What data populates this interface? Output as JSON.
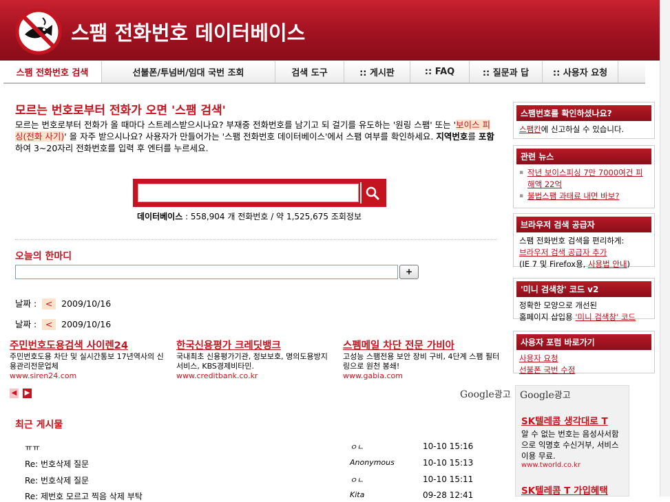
{
  "header": {
    "title": "스팸 전화번호 데이터베이스"
  },
  "nav": [
    {
      "label": "스팸 전화번호 검색",
      "width": 143
    },
    {
      "label": "선불폰/투넘버/임대 국번 조회",
      "width": 252
    },
    {
      "label": "검색 도구",
      "width": 100
    },
    {
      "label": ":: 게시판",
      "width": 96
    },
    {
      "label": ":: FAQ",
      "width": 86
    },
    {
      "label": ":: 질문과 답",
      "width": 106
    },
    {
      "label": ":: 사용자 요청",
      "width": 110
    }
  ],
  "headline": "모르는 번호로부터 전화가 오면 '스팸 검색'",
  "intro": {
    "part1": "모르는 번호로부터 전화가 올 때마다 스트레스받으시나요? 부재중 전화번호를 남기고 되 걸기를 유도하는 '원링 스팸' 또는 '",
    "phishing": "보이스 피싱(전화 사기)",
    "part2": "' 을 자주 받으시나요? 사용자가 만들어가는 '스팸 전화번호 데이터베이스'에서 스팸 여부를 확인하세요. ",
    "bold1": "지역번호",
    "mid": "를 ",
    "bold2": "포함",
    "part3": "하여 3~20자리 전화번호를 입력 후 엔터를 누르세요."
  },
  "search": {
    "placeholder": "",
    "value": ""
  },
  "db": {
    "label": "데이터베이스",
    "phones": "558,904",
    "phones_unit": "개 전화번호 / 약",
    "info": "1,525,675",
    "info_unit": "조회정보"
  },
  "oneline": {
    "title": "오늘의 한마디",
    "plus": "+"
  },
  "dates": [
    {
      "label": "날짜 :",
      "nav": "<",
      "date": "2009/10/16"
    },
    {
      "label": "날짜 :",
      "nav": "<",
      "date": "2009/10/16"
    }
  ],
  "ads": [
    {
      "title": "주민번호도용검색 사이렌24",
      "desc": "주민번호도용 차단 및 실시간통보 17년역사의 신용관리전문업체",
      "url": "www.siren24.com"
    },
    {
      "title": "한국신용평가 크레딧뱅크",
      "desc": "국내최초 신용평가기관, 정보보호, 명의도용방지 서비스, KBS경제비타민.",
      "url": "www.creditbank.co.kr"
    },
    {
      "title": "스펨메일 차단 전문 가비아",
      "desc": "고성능 스팸전용 보안 장비 구비, 4단계 스팸 필터링으로 원천 봉쇄!",
      "url": "www.gabia.com"
    }
  ],
  "google_label": {
    "brand": "Google",
    "suffix": "광고"
  },
  "posts": {
    "title": "최근 게시물",
    "items": [
      {
        "title": "ㅠㅠ",
        "author": "ㅇㄴ",
        "time": "10-10 15:16"
      },
      {
        "title": "Re: 번호삭제 질문",
        "author": "Anonymous",
        "time": "10-10 15:13"
      },
      {
        "title": "Re: 번호삭제 질문",
        "author": "ㅇㄴ",
        "time": "10-10 15:11"
      },
      {
        "title": "Re: 제번호 모르고 찍음 삭제 부탁",
        "author": "Kita",
        "time": "09-28 12:41"
      }
    ]
  },
  "side": {
    "box1": {
      "title": "스팸번호를 확인하셨나요?",
      "link": "스팸칸",
      "text": "에 신고하실 수 있습니다."
    },
    "box2": {
      "title": "관련 뉴스",
      "items": [
        "작년 보이스피싱 7만 7000여건 피해액 22억",
        "불법스팸 과태료 내면 바보?"
      ]
    },
    "box3": {
      "title": "브라우저 검색 공급자",
      "line1": "스팸 전화번호 검색을 편리하게:",
      "link1": "브라우저 검색 공급자 추가",
      "line2a": "(IE 7 및 Firefox용, ",
      "link2": "사용법 안내",
      "line2b": ")"
    },
    "box4": {
      "title": "'미니 검색창' 코드 v2",
      "line1": "정확한 모양으로 개선된",
      "line2a": "홈페이지 삽입용 ",
      "link": "'미니 검색창' 코드"
    },
    "box5": {
      "title": "사용자 포럼 바로가기",
      "links": [
        "사용자 요청",
        "선불폰 국번 수정"
      ]
    }
  },
  "side_ad": {
    "title": "SK텔레콤 생각대로 T",
    "desc": "알 수 없는 번호는 음성사서함으로 익명호 수신거부, 서비스 이용 무료.",
    "url": "www.tworld.co.kr",
    "title2": "SK텔레콤 T 가입혜택"
  },
  "colors": {
    "accent": "#c4141f",
    "header": "#a11220"
  }
}
